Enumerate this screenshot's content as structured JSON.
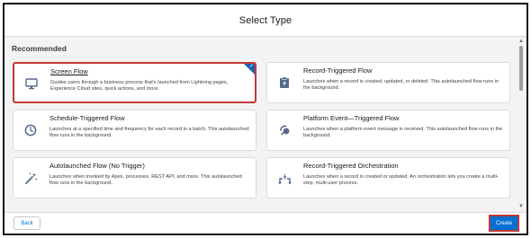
{
  "modal": {
    "title": "Select Type"
  },
  "section": {
    "title": "Recommended"
  },
  "cards": [
    {
      "title": "Screen Flow",
      "description": "Guides users through a business process that's launched from Lightning pages, Experience Cloud sites, quick actions, and more.",
      "icon": "monitor-icon"
    },
    {
      "title": "Record-Triggered Flow",
      "description": "Launches when a record is created, updated, or deleted. This autolaunched flow runs in the background.",
      "icon": "record-triggered-icon"
    },
    {
      "title": "Schedule-Triggered Flow",
      "description": "Launches at a specified time and frequency for each record in a batch. This autolaunched flow runs in the background.",
      "icon": "clock-icon"
    },
    {
      "title": "Platform Event—Triggered Flow",
      "description": "Launches when a platform event message is received. This autolaunched flow runs in the background.",
      "icon": "platform-event-icon"
    },
    {
      "title": "Autolaunched Flow (No Trigger)",
      "description": "Launches when invoked by Apex, processes, REST API, and more. This autolaunched flow runs in the background.",
      "icon": "magic-wand-icon"
    },
    {
      "title": "Record-Triggered Orchestration",
      "description": "Launches when a record is created or updated. An orchestration lets you create a multi-step, multi-user process.",
      "icon": "orchestration-icon"
    }
  ],
  "footer": {
    "back_label": "Back",
    "create_label": "Create"
  },
  "colors": {
    "accent": "#0070d2",
    "selection_outline": "#c23934",
    "selected_badge": "#1b5fb7"
  }
}
